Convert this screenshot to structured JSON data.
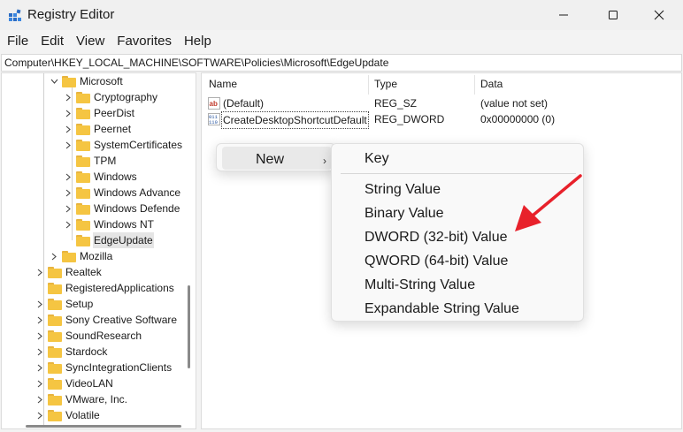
{
  "window": {
    "title": "Registry Editor",
    "icon": "registry-editor-icon",
    "controls": [
      "minimize-icon",
      "maximize-icon",
      "close-icon"
    ]
  },
  "menu": [
    "File",
    "Edit",
    "View",
    "Favorites",
    "Help"
  ],
  "address": "Computer\\HKEY_LOCAL_MACHINE\\SOFTWARE\\Policies\\Microsoft\\EdgeUpdate",
  "tree": [
    {
      "label": "Microsoft",
      "expanded": true
    },
    {
      "label": "Cryptography"
    },
    {
      "label": "PeerDist"
    },
    {
      "label": "Peernet"
    },
    {
      "label": "SystemCertificates"
    },
    {
      "label": "TPM"
    },
    {
      "label": "Windows"
    },
    {
      "label": "Windows Advance"
    },
    {
      "label": "Windows Defende"
    },
    {
      "label": "Windows NT"
    },
    {
      "label": "EdgeUpdate",
      "selected": true
    },
    {
      "label": "Mozilla"
    },
    {
      "label": "Realtek"
    },
    {
      "label": "RegisteredApplications"
    },
    {
      "label": "Setup"
    },
    {
      "label": "Sony Creative Software"
    },
    {
      "label": "SoundResearch"
    },
    {
      "label": "Stardock"
    },
    {
      "label": "SyncIntegrationClients"
    },
    {
      "label": "VideoLAN"
    },
    {
      "label": "VMware, Inc."
    },
    {
      "label": "Volatile"
    }
  ],
  "values": {
    "headers": {
      "name": "Name",
      "type": "Type",
      "data": "Data"
    },
    "rows": [
      {
        "name": "(Default)",
        "type": "REG_SZ",
        "data": "(value not set)",
        "icon": "string-value-icon"
      },
      {
        "name": "CreateDesktopShortcutDefault",
        "type": "REG_DWORD",
        "data": "0x00000000 (0)",
        "icon": "binary-value-icon"
      }
    ]
  },
  "context_menu": {
    "new_label": "New",
    "submenu": [
      "Key",
      "String Value",
      "Binary Value",
      "DWORD (32-bit) Value",
      "QWORD (64-bit) Value",
      "Multi-String Value",
      "Expandable String Value"
    ]
  },
  "colors": {
    "folder": "#f5c542",
    "annotation_arrow": "#e8212b",
    "selection": "#e5e5e5"
  }
}
